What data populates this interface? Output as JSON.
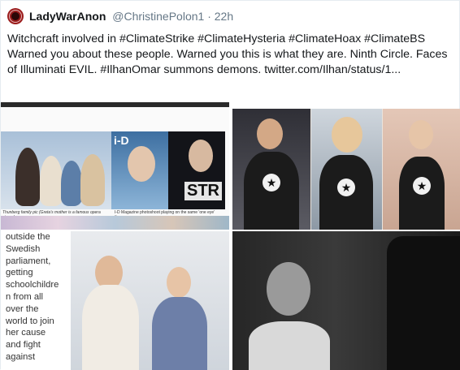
{
  "tweet": {
    "display_name": "LadyWarAnon",
    "handle": "@ChristinePolon1",
    "separator": "·",
    "time": "22h",
    "text": "Witchcraft involved in #ClimateStrike #ClimateHysteria  #ClimateHoax #ClimateBS  Warned you about these people. Warned you this is what they are. Ninth Circle. Faces of Illuminati EVIL. #IlhanOmar summons demons. twitter.com/Ilhan/status/1..."
  },
  "media": {
    "collage": {
      "caption_left": "Thunberg family pic (Greta's mother is a famous opera singer)",
      "caption_right": "I-D Magazine photoshoot playing on the same 'one eye' theme",
      "mag_logo": "i-D",
      "strike_text": "STR"
    },
    "text_overlay_lines": [
      "outside the",
      "Swedish",
      "parliament,",
      "getting",
      "schoolchildre",
      "n from all",
      "over the",
      "world to join",
      "her cause",
      "and fight",
      "against"
    ],
    "star_glyph": "★"
  },
  "colors": {
    "name": "#14171a",
    "secondary": "#657786",
    "avatar": "#9b1c1c"
  }
}
